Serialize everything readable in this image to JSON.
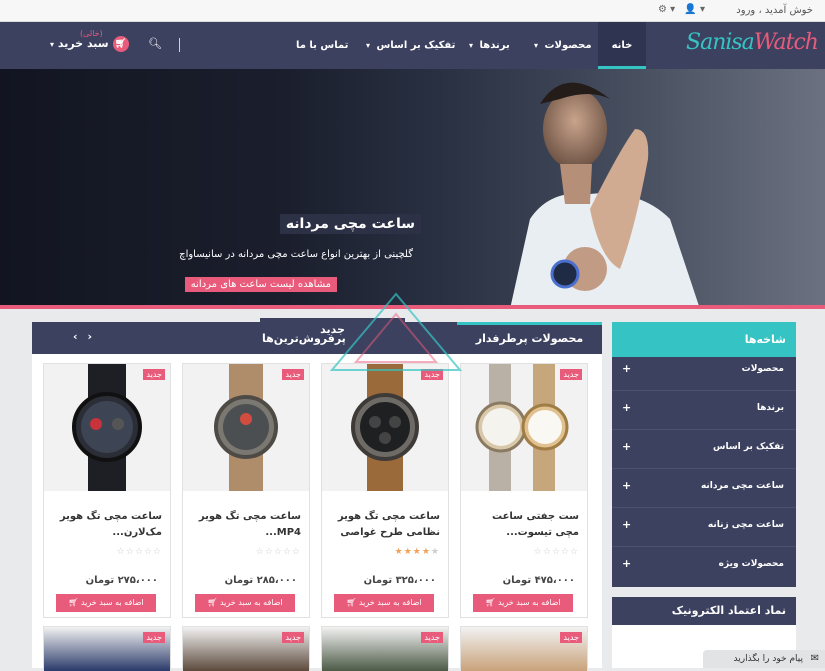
{
  "topbar": {
    "welcome": "خوش آمدید ،",
    "login": "ورود"
  },
  "logo": {
    "part1": "Sanisa",
    "part2": "Watch"
  },
  "nav": {
    "home": "خانه",
    "products": "محصولات",
    "brands": "برندها",
    "separation": "تفکیک بر اساس",
    "contact": "تماس با ما"
  },
  "cart": {
    "label": "سبد خرید",
    "empty": "(خالی)"
  },
  "hero": {
    "title": "ساعت مچی مردانه",
    "subtitle": "گلچینی از بهترین انواع ساعت مچی مردانه در سانیساواچ",
    "button": "مشاهده لیست ساعت های مردانه"
  },
  "tabs": {
    "active": "محصولات پرطرفدار",
    "new": "جدید",
    "best": "پرفروش‌ترین‌ها"
  },
  "products": [
    {
      "title": "ست جفتی ساعت مچی تیسوت...",
      "price": "۴۷۵،۰۰۰ تومان",
      "rating": 0,
      "badge": "جدید",
      "button": "اضافه به سبد خرید"
    },
    {
      "title": "ساعت مچی تگ هویر نظامی طرح غواصی",
      "price": "۳۲۵،۰۰۰ تومان",
      "rating": 4,
      "badge": "جدید",
      "button": "اضافه به سبد خرید"
    },
    {
      "title": "ساعت مچی تگ هویر MP4...",
      "price": "۲۸۵،۰۰۰ تومان",
      "rating": 0,
      "badge": "جدید",
      "button": "اضافه به سبد خرید"
    },
    {
      "title": "ساعت مچی تگ هویر مک‌لارن...",
      "price": "۲۷۵،۰۰۰ تومان",
      "rating": 0,
      "badge": "جدید",
      "button": "اضافه به سبد خرید"
    }
  ],
  "row2_badges": [
    "جدید",
    "جدید",
    "جدید",
    "جدید"
  ],
  "sidebar": {
    "title": "شاخه‌ها",
    "items": [
      "محصولات",
      "برندها",
      "تفکیک بر اساس",
      "ساعت مچی مردانه",
      "ساعت مچی زنانه",
      "محصولات ویژه"
    ]
  },
  "trust": {
    "title": "نماد اعتماد الکترونیک"
  },
  "chat": {
    "label": "پیام خود را بگذارید"
  },
  "colors": {
    "navy": "#3c4160",
    "teal": "#36c3c3",
    "pink": "#e95b7b"
  }
}
